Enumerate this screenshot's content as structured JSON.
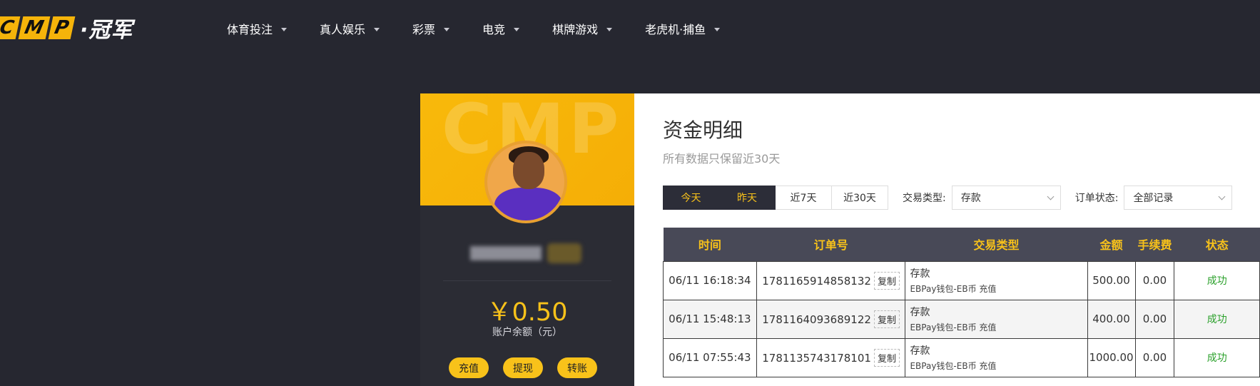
{
  "logo": {
    "box_letters": [
      "C",
      "M",
      "P"
    ],
    "text": "·冠军"
  },
  "nav": {
    "items": [
      {
        "label": "体育投注"
      },
      {
        "label": "真人娱乐"
      },
      {
        "label": "彩票"
      },
      {
        "label": "电竞"
      },
      {
        "label": "棋牌游戏"
      },
      {
        "label": "老虎机·捕鱼"
      }
    ]
  },
  "profile": {
    "watermark": "CMP",
    "balance": "￥0.50",
    "balance_label": "账户余额（元）",
    "buttons": {
      "deposit": "充值",
      "withdraw": "提现",
      "transfer": "转账"
    }
  },
  "main": {
    "title": "资金明细",
    "subtitle": "所有数据只保留近30天",
    "periods": [
      {
        "label": "今天",
        "active": true
      },
      {
        "label": "昨天",
        "active": true
      },
      {
        "label": "近7天",
        "active": false
      },
      {
        "label": "近30天",
        "active": false
      }
    ],
    "type_filter": {
      "label": "交易类型:",
      "value": "存款"
    },
    "status_filter": {
      "label": "订单状态:",
      "value": "全部记录"
    },
    "table": {
      "headers": {
        "time": "时间",
        "order": "订单号",
        "type": "交易类型",
        "amount": "金额",
        "fee": "手续费",
        "status": "状态"
      },
      "copy_label": "复制",
      "rows": [
        {
          "time": "06/11 16:18:34",
          "order": "1781165914858132",
          "type": "存款",
          "type_detail": "EBPay钱包-EB币 充值",
          "amount": "500.00",
          "fee": "0.00",
          "status": "成功"
        },
        {
          "time": "06/11 15:48:13",
          "order": "1781164093689122",
          "type": "存款",
          "type_detail": "EBPay钱包-EB币 充值",
          "amount": "400.00",
          "fee": "0.00",
          "status": "成功"
        },
        {
          "time": "06/11 07:55:43",
          "order": "1781135743178101",
          "type": "存款",
          "type_detail": "EBPay钱包-EB币 充值",
          "amount": "1000.00",
          "fee": "0.00",
          "status": "成功"
        }
      ]
    }
  },
  "colors": {
    "accent": "#f8c21a",
    "dark_bg": "#262730",
    "success": "#2aa02a"
  }
}
